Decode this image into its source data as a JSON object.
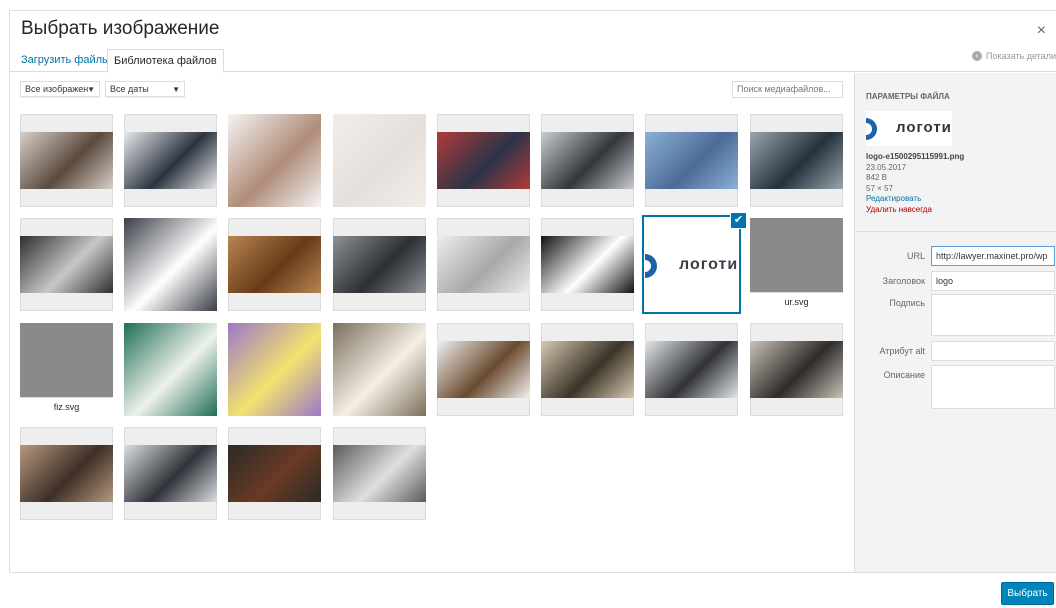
{
  "modal": {
    "title": "Выбрать изображение",
    "close": "×"
  },
  "tabs": [
    {
      "label": "Загрузить файлы"
    },
    {
      "label": "Библиотека файлов"
    }
  ],
  "show_details": "Показать детали",
  "filters": {
    "type": "Все изображен",
    "date": "Все даты",
    "search_placeholder": "Поиск медиафайлов..."
  },
  "grid": [
    {
      "cap": "",
      "c1": "#5b4a3e",
      "c2": "#d8d0c8"
    },
    {
      "cap": "",
      "c1": "#2c3440",
      "c2": "#e8eaec"
    },
    {
      "cap": "",
      "c1": "#b08c78",
      "c2": "#f4f4f4"
    },
    {
      "cap": "",
      "c1": "#e6e0dc",
      "c2": "#f2ede9"
    },
    {
      "cap": "",
      "c1": "#2b3448",
      "c2": "#b33a3a"
    },
    {
      "cap": "",
      "c1": "#33363b",
      "c2": "#c9ccd0"
    },
    {
      "cap": "",
      "c1": "#4b6b96",
      "c2": "#8cb0d8"
    },
    {
      "cap": "",
      "c1": "#24313b",
      "c2": "#9aa6ae"
    },
    {
      "cap": "",
      "c1": "#c8c8c8",
      "c2": "#2e2e2e"
    },
    {
      "cap": "",
      "c1": "#ffffff",
      "c2": "#3a3e46"
    },
    {
      "cap": "",
      "c1": "#6a3a18",
      "c2": "#b58650"
    },
    {
      "cap": "",
      "c1": "#2c2f33",
      "c2": "#8d9297"
    },
    {
      "cap": "",
      "c1": "#a8a8a8",
      "c2": "#eeeeee"
    },
    {
      "cap": "",
      "c1": "#ffffff",
      "c2": "#111111"
    },
    {
      "cap": "",
      "c1": "#ffffff",
      "c2": "#314f6b"
    },
    {
      "cap": "ur.svg",
      "c1": "#8a8a8a",
      "c2": "#8a8a8a"
    },
    {
      "cap": "fiz.svg",
      "c1": "#8a8a8a",
      "c2": "#8a8a8a"
    },
    {
      "cap": "",
      "c1": "#eef2ea",
      "c2": "#1f6e56"
    },
    {
      "cap": "",
      "c1": "#f2e36e",
      "c2": "#9c78c8"
    },
    {
      "cap": "",
      "c1": "#f4efe4",
      "c2": "#7b6f5c"
    },
    {
      "cap": "",
      "c1": "#6a4a2e",
      "c2": "#f1f1f1"
    },
    {
      "cap": "",
      "c1": "#3b3428",
      "c2": "#d8c8b0"
    },
    {
      "cap": "",
      "c1": "#313336",
      "c2": "#e2e6ea"
    },
    {
      "cap": "",
      "c1": "#2e2b29",
      "c2": "#c9c2b8"
    },
    {
      "cap": "",
      "c1": "#3e2f26",
      "c2": "#b59980"
    },
    {
      "cap": "",
      "c1": "#2f3238",
      "c2": "#dcdfe2"
    },
    {
      "cap": "",
      "c1": "#6a3a24",
      "c2": "#2b2a28"
    },
    {
      "cap": "",
      "c1": "#e0e0e0",
      "c2": "#5a5a5a"
    }
  ],
  "details": {
    "heading": "ПАРАМЕТРЫ ФАЙЛА",
    "logo_text": "логоти",
    "filename": "logo-e1500295115991.png",
    "date": "23.05.2017",
    "size": "842 B",
    "dims": "57 × 57",
    "edit": "Редактировать",
    "delete": "Удалить навсегда",
    "url_label": "URL",
    "url_value": "http://lawyer.maxinet.pro/wp",
    "title_label": "Заголовок",
    "title_value": "logo",
    "caption_label": "Подпись",
    "alt_label": "Атрибут alt",
    "desc_label": "Описание"
  },
  "footer": {
    "select": "Выбрать"
  },
  "colors": {
    "accent": "#0073aa",
    "primary_button": "#0085ba",
    "danger": "#a00000"
  }
}
